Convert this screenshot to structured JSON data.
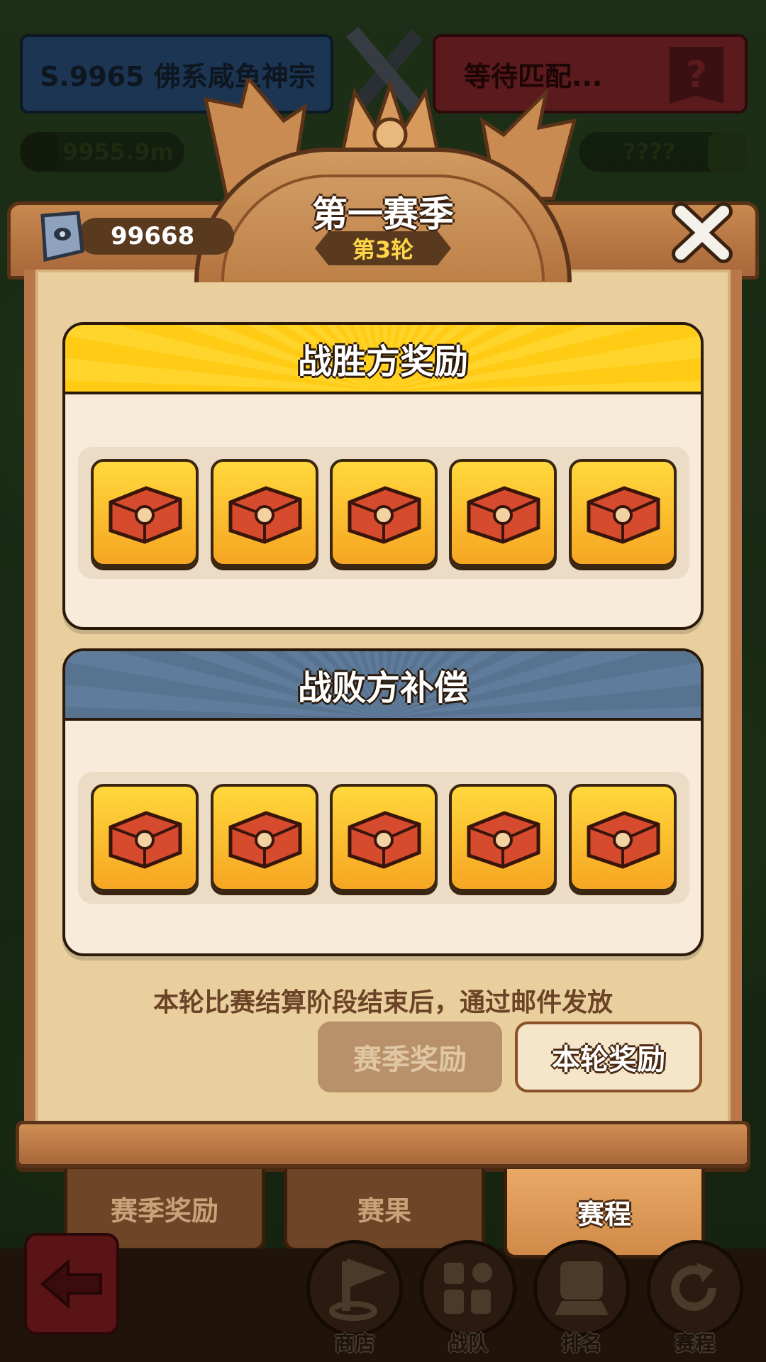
{
  "match": {
    "left_team": "S.9965 佛系咸鱼神宗",
    "right_team": "等待匹配...",
    "unknown_mark": "?",
    "left_power": "9955.9m",
    "right_power": "????"
  },
  "panel": {
    "title": "第一赛季",
    "round": "第3轮",
    "currency_value": "99668"
  },
  "winner_section": {
    "title": "战胜方奖励",
    "rewards": [
      "chest",
      "chest",
      "chest",
      "chest",
      "chest"
    ]
  },
  "loser_section": {
    "title": "战败方补偿",
    "rewards": [
      "chest",
      "chest",
      "chest",
      "chest",
      "chest"
    ]
  },
  "note": "本轮比赛结算阶段结束后，通过邮件发放",
  "reward_tabs": {
    "season": "赛季奖励",
    "round": "本轮奖励"
  },
  "bottom_tabs": {
    "season_rewards": "赛季奖励",
    "results": "赛果",
    "schedule": "赛程"
  },
  "nav": {
    "shop": "商店",
    "team": "战队",
    "rank": "排名",
    "schedule": "赛程"
  },
  "icons": {
    "close": "close-icon",
    "currency": "stone-tablet-icon",
    "back": "back-arrow-icon"
  }
}
